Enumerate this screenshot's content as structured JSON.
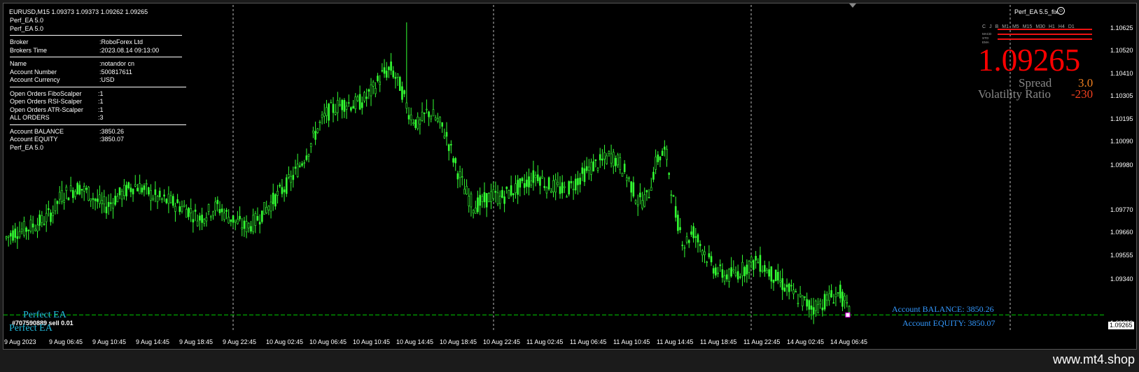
{
  "chart": {
    "symbol_line": "EURUSD,M15  1.09373 1.09373 1.09262 1.09265",
    "ea_label_right": "Perf_EA 5.5_fix",
    "current_price_tag": "1.09265"
  },
  "info_panel": {
    "header_lines": [
      "Perf_EA 5.0",
      "Perf_EA 5.0"
    ],
    "groups": [
      [
        {
          "k": "Broker",
          "v": ":RoboForex Ltd"
        },
        {
          "k": "Brokers Time",
          "v": ":2023.08.14 09:13:00"
        }
      ],
      [
        {
          "k": "Name",
          "v": ":notandor cn"
        },
        {
          "k": "Account Number",
          "v": ":500817611"
        },
        {
          "k": "Account Currency",
          "v": ":USD"
        }
      ],
      [
        {
          "k": "Open Orders FiboScalper",
          "v": ":1"
        },
        {
          "k": "Open Orders RSI-Scalper",
          "v": ":1"
        },
        {
          "k": "Open Orders ATR-Scalper",
          "v": ":1"
        },
        {
          "k": "ALL ORDERS",
          "v": ":3"
        }
      ],
      [
        {
          "k": "Account BALANCE",
          "v": ":3850.26"
        },
        {
          "k": "Account EQUITY",
          "v": ":3850.07"
        }
      ]
    ],
    "footer": "Perf_EA 5.0"
  },
  "dashboard": {
    "timeframes": [
      "C",
      "J",
      "B",
      "M1",
      "M5",
      "M15",
      "M30",
      "H1",
      "H4",
      "D1"
    ],
    "indicators": [
      "MACD",
      "STO",
      "EMA"
    ],
    "price": "1.09265",
    "spread_label": "Spread",
    "spread_value": "3.0",
    "volatility_label": "Volatility Ratio",
    "volatility_value": "-230"
  },
  "overlay": {
    "perfect_ea_1": "Perfect EA",
    "perfect_ea_2": "Perfect EA",
    "order_label": "#707590889 sell 0.01",
    "account_balance": "Account BALANCE:  3850.26",
    "account_equity": "Account EQUITY:  3850.07"
  },
  "y_axis": [
    "1.10625",
    "1.10520",
    "1.10410",
    "1.10305",
    "1.10195",
    "1.10090",
    "1.09980",
    "1.09770",
    "1.09660",
    "1.09555",
    "1.09340",
    "1.09230"
  ],
  "x_axis": [
    "9 Aug 2023",
    "9 Aug 06:45",
    "9 Aug 10:45",
    "9 Aug 14:45",
    "9 Aug 18:45",
    "9 Aug 22:45",
    "10 Aug 02:45",
    "10 Aug 06:45",
    "10 Aug 10:45",
    "10 Aug 14:45",
    "10 Aug 18:45",
    "10 Aug 22:45",
    "11 Aug 02:45",
    "11 Aug 06:45",
    "11 Aug 10:45",
    "11 Aug 14:45",
    "11 Aug 18:45",
    "11 Aug 22:45",
    "14 Aug 02:45",
    "14 Aug 06:45"
  ],
  "watermark": "www.mt4.shop",
  "colors": {
    "candle": "#33ff33",
    "price_line": "#00cc00",
    "big_price": "#ff0000"
  },
  "chart_data": {
    "type": "candlestick",
    "symbol": "EURUSD",
    "timeframe": "M15",
    "ylim": [
      1.0923,
      1.1068
    ],
    "close_series": [
      1.0963,
      1.0966,
      1.0967,
      1.0969,
      1.0971,
      1.0975,
      1.0983,
      1.0985,
      1.0987,
      1.0984,
      1.098,
      1.0978,
      1.0982,
      1.0985,
      1.0988,
      1.0986,
      1.0983,
      1.0981,
      1.098,
      1.0978,
      1.0976,
      1.0972,
      1.0975,
      1.0978,
      1.0974,
      1.0971,
      1.0968,
      1.097,
      1.0975,
      1.098,
      1.0985,
      1.099,
      1.0997,
      1.1005,
      1.1015,
      1.1022,
      1.1025,
      1.1027,
      1.1026,
      1.1028,
      1.1033,
      1.104,
      1.1043,
      1.1035,
      1.1022,
      1.1016,
      1.1023,
      1.1019,
      1.1012,
      1.0998,
      1.0986,
      1.0978,
      1.098,
      1.0983,
      1.0982,
      1.0985,
      1.0987,
      1.099,
      1.0993,
      1.0988,
      1.0987,
      1.0985,
      1.0989,
      1.0993,
      1.0997,
      1.0999,
      1.1002,
      1.0998,
      1.099,
      1.098,
      1.0982,
      1.1,
      1.1004,
      1.0975,
      1.096,
      1.0966,
      1.0958,
      1.095,
      1.0946,
      1.0945,
      1.0947,
      1.095,
      1.0952,
      1.0948,
      1.0944,
      1.094,
      1.0936,
      1.0933,
      1.093,
      1.0932,
      1.0935,
      1.0937,
      1.0927
    ],
    "last_price": 1.09265
  }
}
